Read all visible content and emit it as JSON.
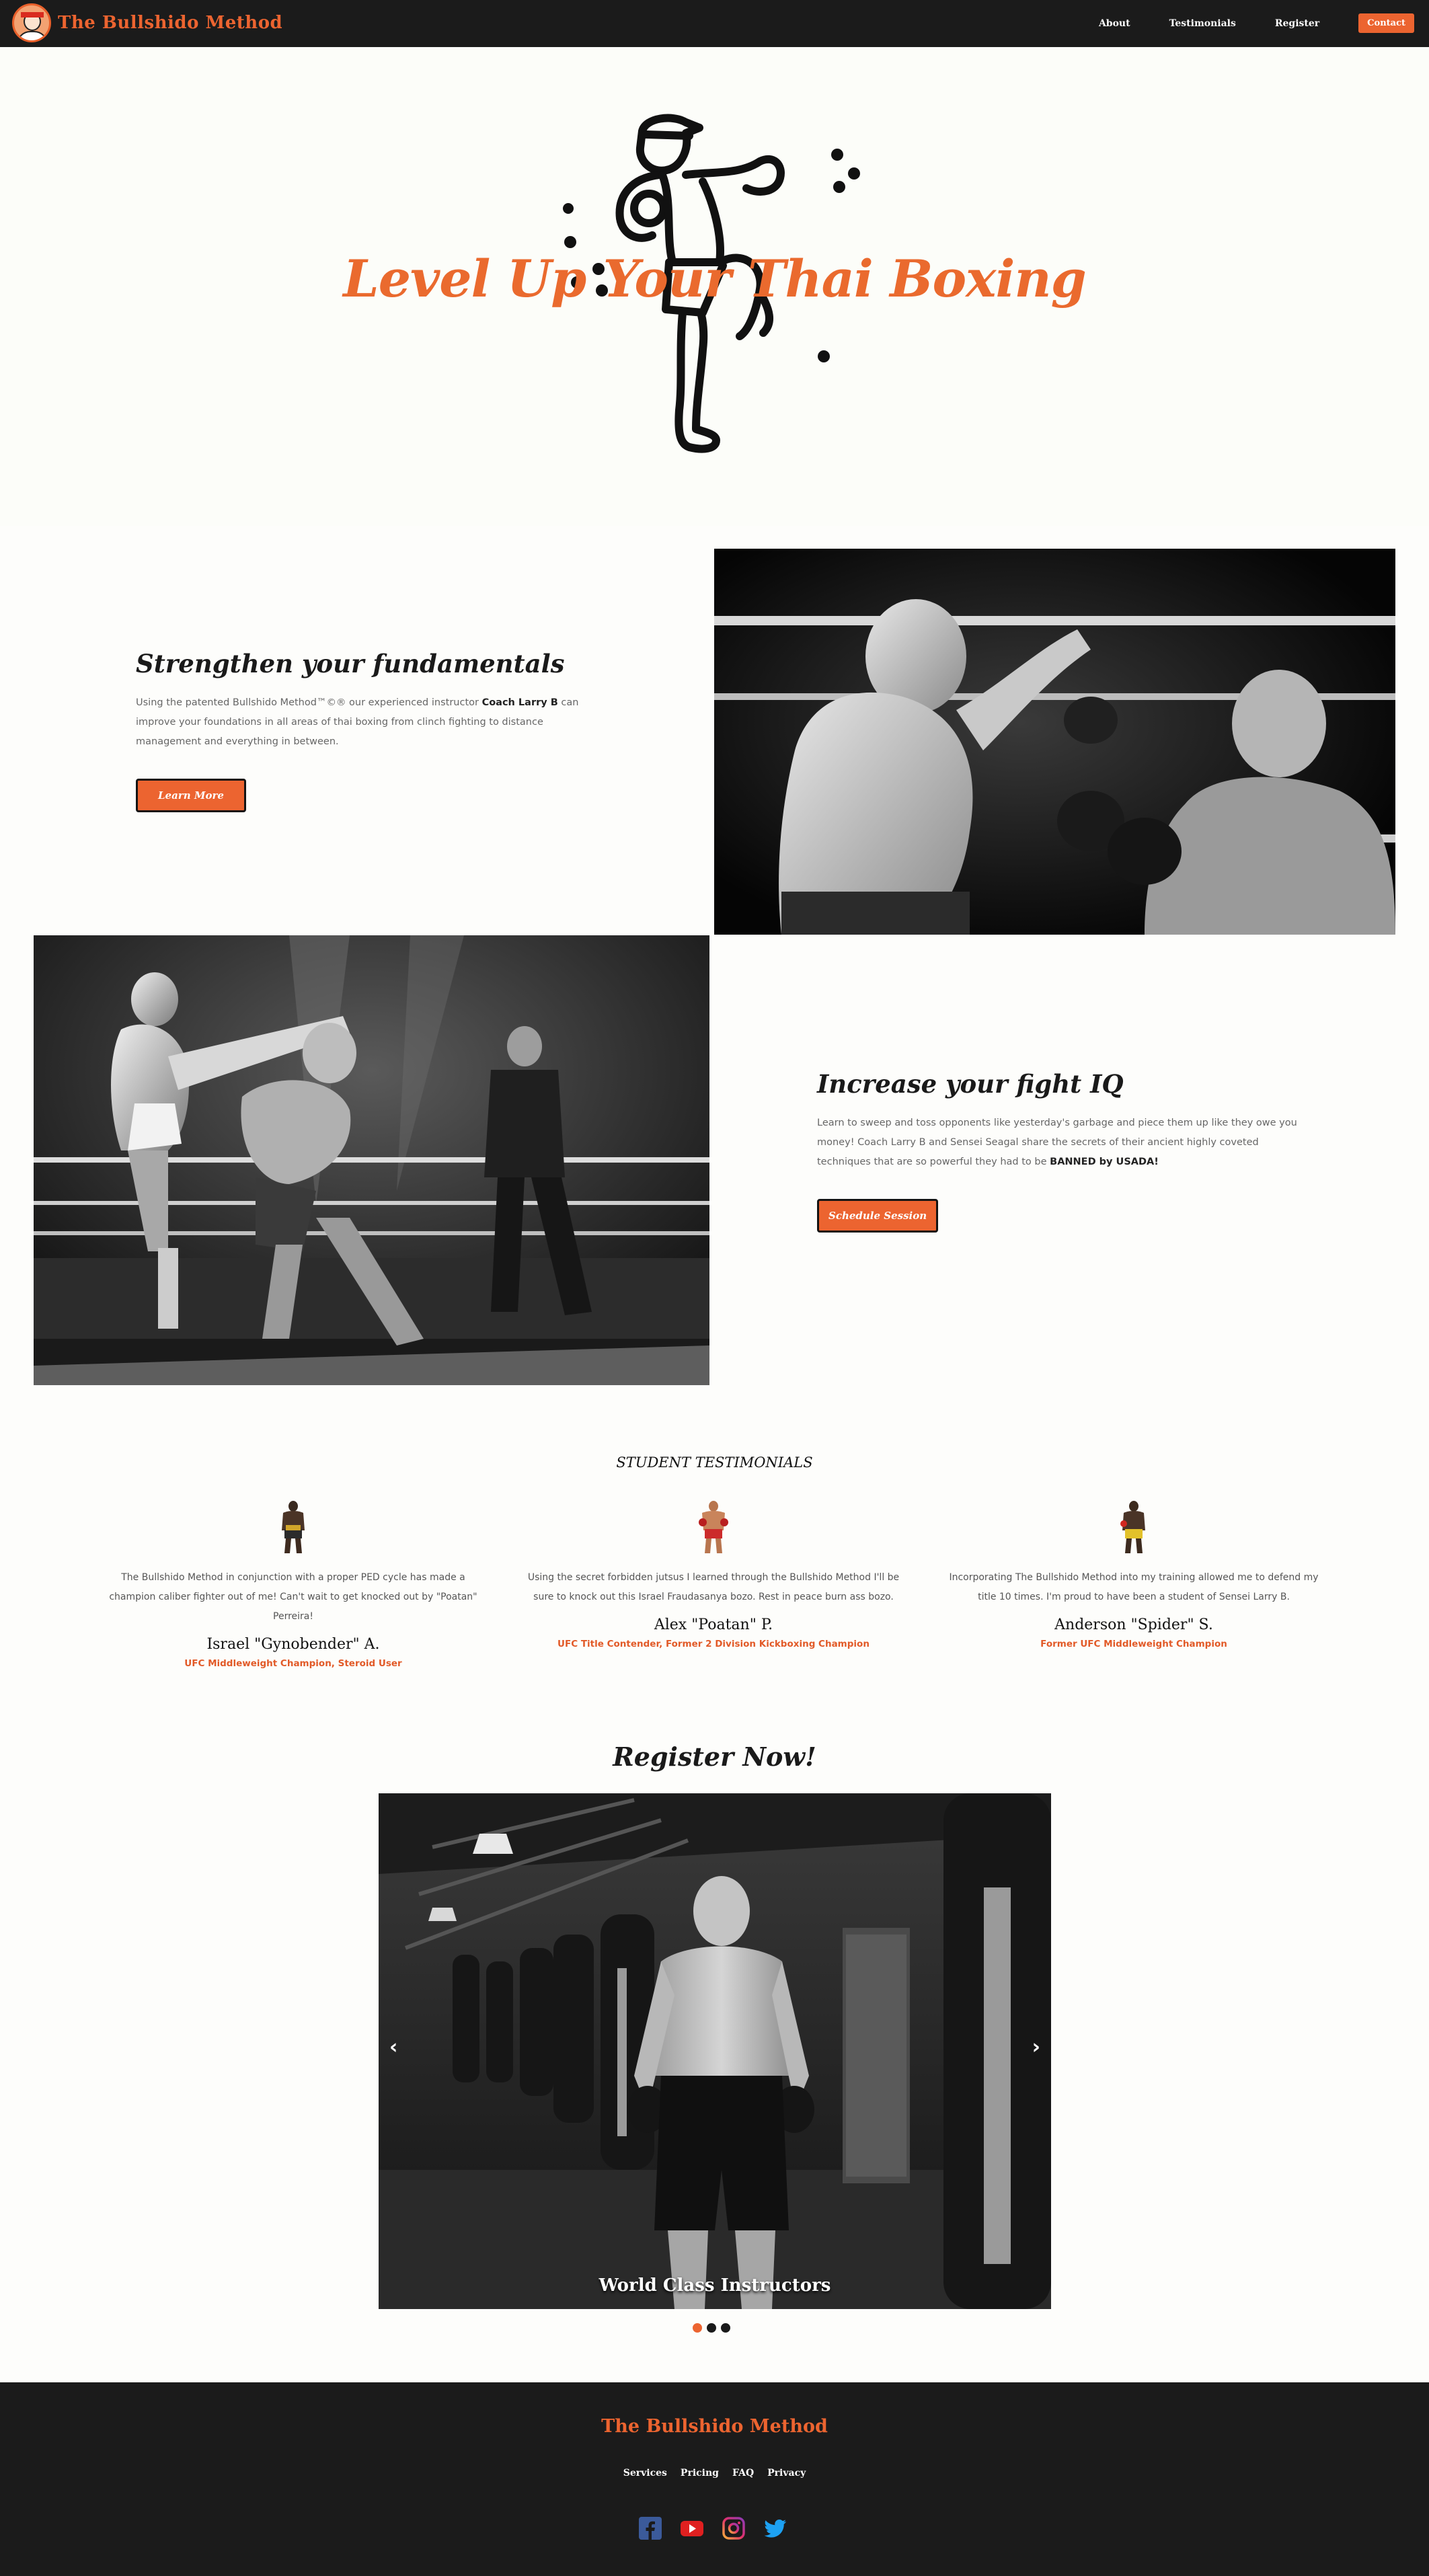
{
  "nav": {
    "brand": "The Bullshido Method",
    "links": [
      "About",
      "Testimonials",
      "Register"
    ],
    "contact": "Contact"
  },
  "hero": {
    "title": "Level Up Your Thai Boxing"
  },
  "features": [
    {
      "title": "Strengthen your fundamentals",
      "body_pre": "Using the patented Bullshido Method™©® our experienced instructor ",
      "body_bold": "Coach Larry B",
      "body_post": " can improve your foundations in all areas of thai boxing from clinch fighting to distance management and everything in between.",
      "button": "Learn More"
    },
    {
      "title": "Increase your fight IQ",
      "body_pre": "Learn to sweep and toss opponents like yesterday's garbage and piece them up like they owe you money! Coach Larry B and Sensei Seagal share the secrets of their ancient highly coveted techniques that are so powerful they had to be ",
      "body_bold": "BANNED by USADA!",
      "body_post": "",
      "button": "Schedule Session"
    }
  ],
  "testimonials": {
    "heading": "STUDENT TESTIMONIALS",
    "items": [
      {
        "quote": "The Bullshido Method in conjunction with a proper PED cycle has made a champion caliber fighter out of me! Can't wait to get knocked out by \"Poatan\" Perreira!",
        "name": "Israel \"Gynobender\" A.",
        "role": "UFC Middleweight Champion, Steroid User"
      },
      {
        "quote": "Using the secret forbidden jutsus I learned through the Bullshido Method I'll be sure to knock out this Israel Fraudasanya bozo. Rest in peace burn ass bozo.",
        "name": "Alex \"Poatan\" P.",
        "role": "UFC Title Contender, Former 2 Division Kickboxing Champion"
      },
      {
        "quote": "Incorporating The Bullshido Method into my training allowed me to defend my title 10 times. I'm proud to have been a student of Sensei Larry B.",
        "name": "Anderson \"Spider\" S.",
        "role": "Former UFC Middleweight Champion"
      }
    ]
  },
  "register": {
    "title": "Register Now!",
    "caption": "World Class Instructors",
    "prev": "‹",
    "next": "›"
  },
  "footer": {
    "brand": "The Bullshido Method",
    "links": [
      "Services",
      "Pricing",
      "FAQ",
      "Privacy"
    ],
    "socials": [
      "facebook-icon",
      "youtube-icon",
      "instagram-icon",
      "twitter-icon"
    ]
  },
  "colors": {
    "accent": "#ec6430",
    "dark": "#1b1b1b",
    "background": "#fdfdfb"
  }
}
